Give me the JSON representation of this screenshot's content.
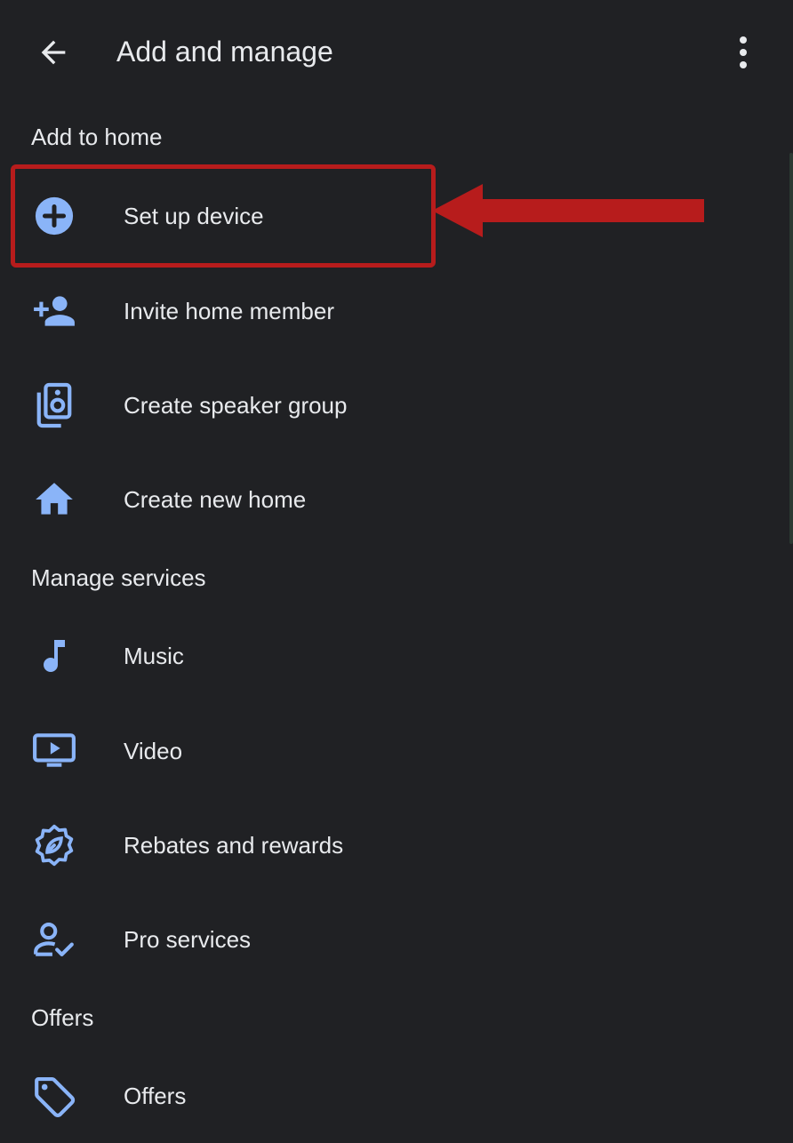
{
  "header": {
    "title": "Add and manage",
    "back_icon": "arrow-back-icon",
    "more_icon": "more-vert-icon"
  },
  "sections": [
    {
      "title": "Add to home",
      "items": [
        {
          "label": "Set up device",
          "icon": "add-circle-icon"
        },
        {
          "label": "Invite home member",
          "icon": "person-add-icon"
        },
        {
          "label": "Create speaker group",
          "icon": "speaker-group-icon"
        },
        {
          "label": "Create new home",
          "icon": "home-icon"
        }
      ]
    },
    {
      "title": "Manage services",
      "items": [
        {
          "label": "Music",
          "icon": "music-note-icon"
        },
        {
          "label": "Video",
          "icon": "video-icon"
        },
        {
          "label": "Rebates and rewards",
          "icon": "rewards-badge-icon"
        },
        {
          "label": "Pro services",
          "icon": "pro-services-icon"
        }
      ]
    },
    {
      "title": "Offers",
      "items": [
        {
          "label": "Offers",
          "icon": "tag-icon"
        }
      ]
    }
  ],
  "colors": {
    "background": "#202124",
    "text": "#e8eaed",
    "icon_accent": "#8ab4f8",
    "annotation_red": "#b71c1c"
  }
}
